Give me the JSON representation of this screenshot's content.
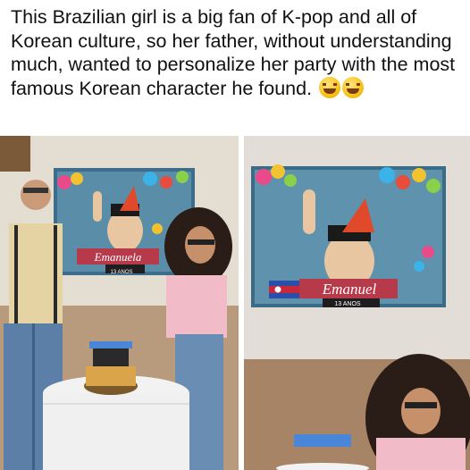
{
  "caption": {
    "text": "This Brazilian girl is a big fan of K-pop and all of Korean culture, so her father, without understanding much, wanted to personalize her party with the most famous Korean character he found.",
    "emoji": "rolling-on-floor-laughing-emoji"
  },
  "photos": [
    {
      "banner_name": "Emanuela",
      "banner_age": "13 ANOS"
    },
    {
      "banner_name": "Emanuel",
      "banner_age": "13 ANOS"
    }
  ]
}
